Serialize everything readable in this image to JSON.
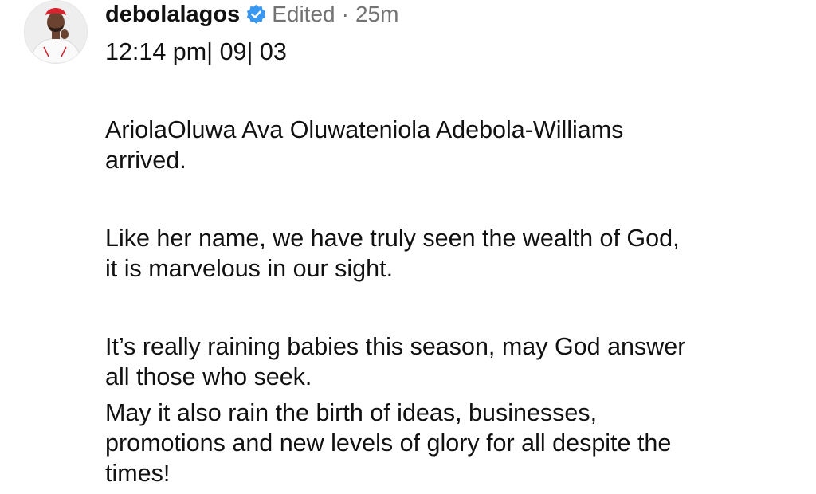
{
  "post": {
    "username": "debolalagos",
    "verified_icon": "verified-badge-icon",
    "edited_label": "Edited",
    "separator": "·",
    "time_ago": "25m",
    "caption_lines": {
      "line1": "12:14 pm| 09| 03",
      "line2": "AriolaOluwa Ava Oluwateniola Adebola-Williams",
      "line3": "arrived.",
      "line4": "Like her name, we have truly seen the wealth of God,",
      "line5": "it is marvelous in our sight.",
      "line6": "It’s really raining babies this season, may God answer",
      "line7": "all those who seek.",
      "line8": "May it also rain the birth of ideas, businesses,",
      "line9": "promotions and new levels of glory for all despite the",
      "line10": "times!"
    }
  },
  "colors": {
    "text": "#111111",
    "muted": "#737373",
    "verified_blue": "#3897f0",
    "cap_red": "#d8242f"
  }
}
